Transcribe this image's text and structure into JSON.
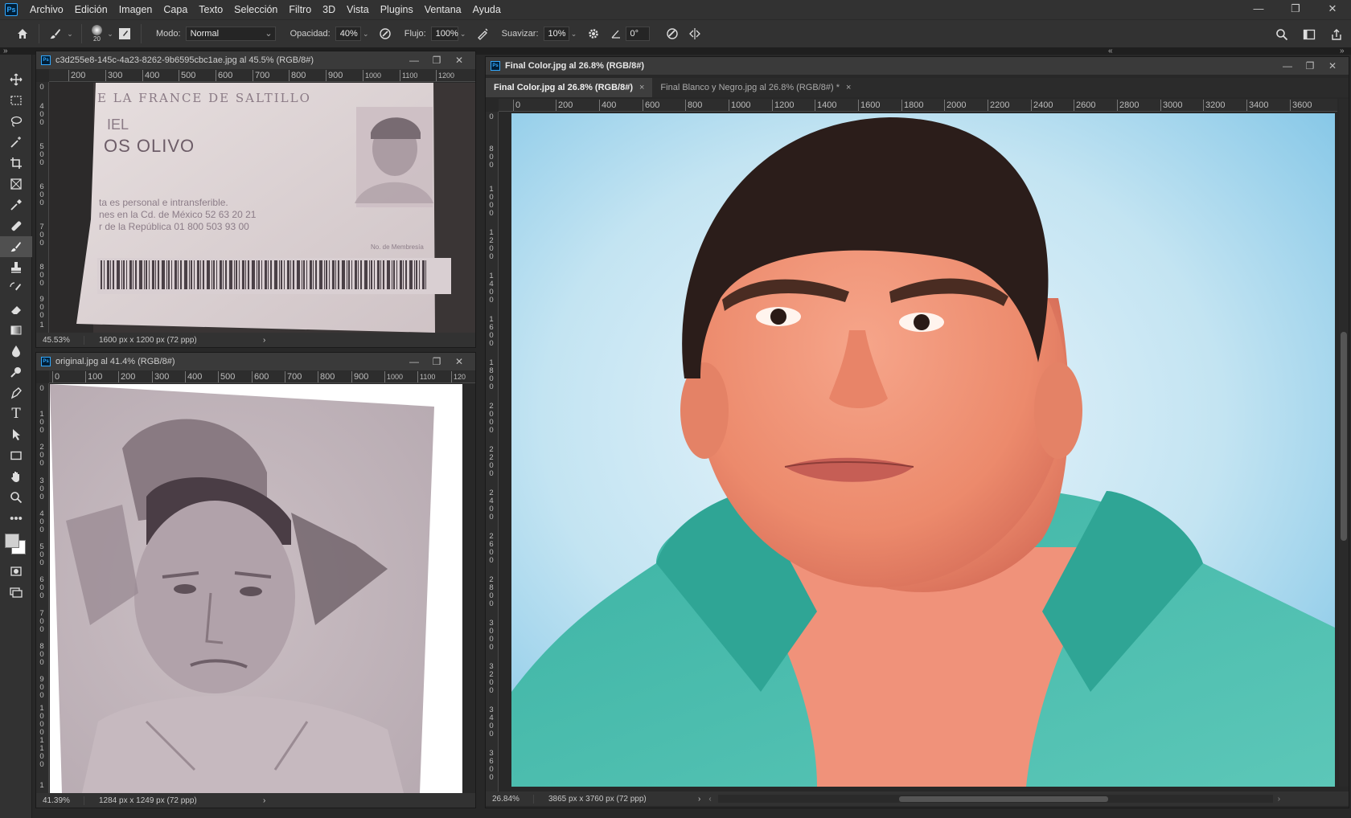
{
  "app": {
    "logo": "Ps"
  },
  "menu": [
    "Archivo",
    "Edición",
    "Imagen",
    "Capa",
    "Texto",
    "Selección",
    "Filtro",
    "3D",
    "Vista",
    "Plugins",
    "Ventana",
    "Ayuda"
  ],
  "window_controls": {
    "minimize": "—",
    "restore": "❐",
    "close": "✕"
  },
  "options": {
    "brush_size": "20",
    "mode_label": "Modo:",
    "mode_value": "Normal",
    "opacity_label": "Opacidad:",
    "opacity_value": "40%",
    "flow_label": "Flujo:",
    "flow_value": "100%",
    "smoothing_label": "Suavizar:",
    "smoothing_value": "10%",
    "angle_value": "0°"
  },
  "panel_collapse": {
    "left": "»",
    "mid": "«",
    "right": "»"
  },
  "doc1": {
    "title": "c3d255e8-145c-4a23-8262-9b6595cbc1ae.jpg al 45.5% (RGB/8#)",
    "zoom": "45.53%",
    "size": "1600 px x 1200 px (72 ppp)",
    "ruler_h": [
      "200",
      "300",
      "400",
      "500",
      "600",
      "700",
      "800",
      "900",
      "1000",
      "1100",
      "1200"
    ],
    "ruler_v": [
      "0",
      "400",
      "500",
      "600",
      "700",
      "800",
      "900",
      "1"
    ],
    "card": {
      "line1": "E LA FRANCE DE SALTILLO",
      "line2": "IEL",
      "line3": "OS OLIVO",
      "line4": "ta es personal e intransferible.",
      "line5": "nes en la Cd. de México 52 63 20 21",
      "line6": "r de la República 01 800 503 93 00",
      "line7": "No. de Membresía"
    }
  },
  "doc2": {
    "title": "original.jpg al 41.4% (RGB/8#)",
    "zoom": "41.39%",
    "size": "1284 px x 1249 px (72 ppp)",
    "ruler_h": [
      "0",
      "100",
      "200",
      "300",
      "400",
      "500",
      "600",
      "700",
      "800",
      "900",
      "1000",
      "1100",
      "120"
    ],
    "ruler_v": [
      "0",
      "100",
      "200",
      "300",
      "400",
      "500",
      "600",
      "700",
      "800",
      "900",
      "1000",
      "1100",
      "1"
    ]
  },
  "doc3": {
    "title": "Final Color.jpg al 26.8% (RGB/8#)",
    "tabs": [
      {
        "label": "Final Color.jpg al 26.8% (RGB/8#)",
        "close": "×"
      },
      {
        "label": "Final Blanco y Negro.jpg al 26.8% (RGB/8#) *",
        "close": "×"
      }
    ],
    "zoom": "26.84%",
    "size": "3865 px x 3760 px (72 ppp)",
    "ruler_h": [
      "0",
      "200",
      "400",
      "600",
      "800",
      "1000",
      "1200",
      "1400",
      "1600",
      "1800",
      "2000",
      "2200",
      "2400",
      "2600",
      "2800",
      "3000",
      "3200",
      "3400",
      "3600"
    ],
    "ruler_v": [
      "0",
      "800",
      "1000",
      "1200",
      "1400",
      "1600",
      "1800",
      "2000",
      "2200",
      "2400",
      "2600",
      "2800",
      "3000",
      "3200",
      "3400",
      "3600"
    ]
  },
  "status_arrow": "›",
  "status_arrow_left": "‹",
  "tool_more": "•••"
}
